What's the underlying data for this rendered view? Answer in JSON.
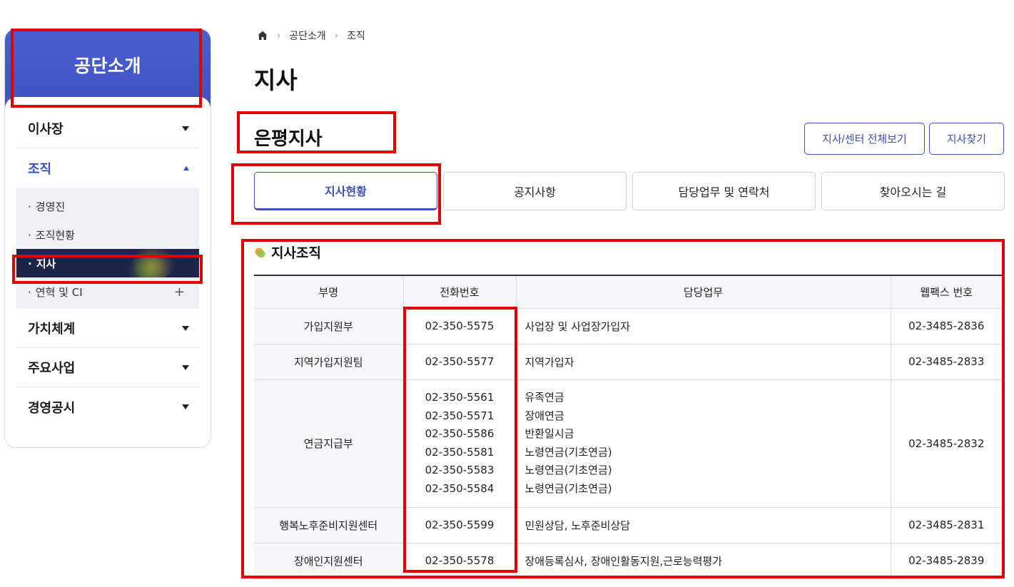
{
  "sidebar": {
    "title": "공단소개",
    "items": [
      {
        "label": "이사장"
      },
      {
        "label": "조직"
      },
      {
        "label": "가치체계"
      },
      {
        "label": "주요사업"
      },
      {
        "label": "경영공시"
      }
    ],
    "sub_items": [
      {
        "label": "경영진"
      },
      {
        "label": "조직현황"
      },
      {
        "label": "지사"
      },
      {
        "label": "연혁 및 CI"
      }
    ]
  },
  "breadcrumb": [
    "공단소개",
    "조직"
  ],
  "page_title": "지사",
  "branch_title": "은평지사",
  "buttons": {
    "all_branches": "지사/센터 전체보기",
    "find_branch": "지사찾기"
  },
  "tabs": [
    "지사현황",
    "공지사항",
    "담당업무 및 연락처",
    "찾아오시는 길"
  ],
  "section_title": "지사조직",
  "table": {
    "headers": [
      "부명",
      "전화번호",
      "담당업무",
      "웹팩스 번호"
    ],
    "rows": [
      {
        "dept": "가입지원부",
        "tel": [
          "02-350-5575"
        ],
        "duty": [
          "사업장 및 사업장가입자"
        ],
        "fax": "02-3485-2836"
      },
      {
        "dept": "지역가입지원팀",
        "tel": [
          "02-350-5577"
        ],
        "duty": [
          "지역가입자"
        ],
        "fax": "02-3485-2833"
      },
      {
        "dept": "연금지급부",
        "tel": [
          "02-350-5561",
          "02-350-5571",
          "02-350-5586",
          "02-350-5581",
          "02-350-5583",
          "02-350-5584"
        ],
        "duty": [
          "유족연금",
          "장애연금",
          "반환일시금",
          "노령연금(기초연금)",
          "노령연금(기초연금)",
          "노령연금(기초연금)"
        ],
        "fax": "02-3485-2832"
      },
      {
        "dept": "행복노후준비지원센터",
        "tel": [
          "02-350-5599"
        ],
        "duty": [
          "민원상담, 노후준비상담"
        ],
        "fax": "02-3485-2831"
      },
      {
        "dept": "장애인지원센터",
        "tel": [
          "02-350-5578"
        ],
        "duty": [
          "장애등록심사, 장애인활동지원,근로능력평가"
        ],
        "fax": "02-3485-2839"
      }
    ]
  },
  "colors": {
    "primary": "#3f51b5",
    "sidebar_head": "#4a5fd0",
    "active_sub": "#1f254a",
    "highlight": "#e00000"
  }
}
